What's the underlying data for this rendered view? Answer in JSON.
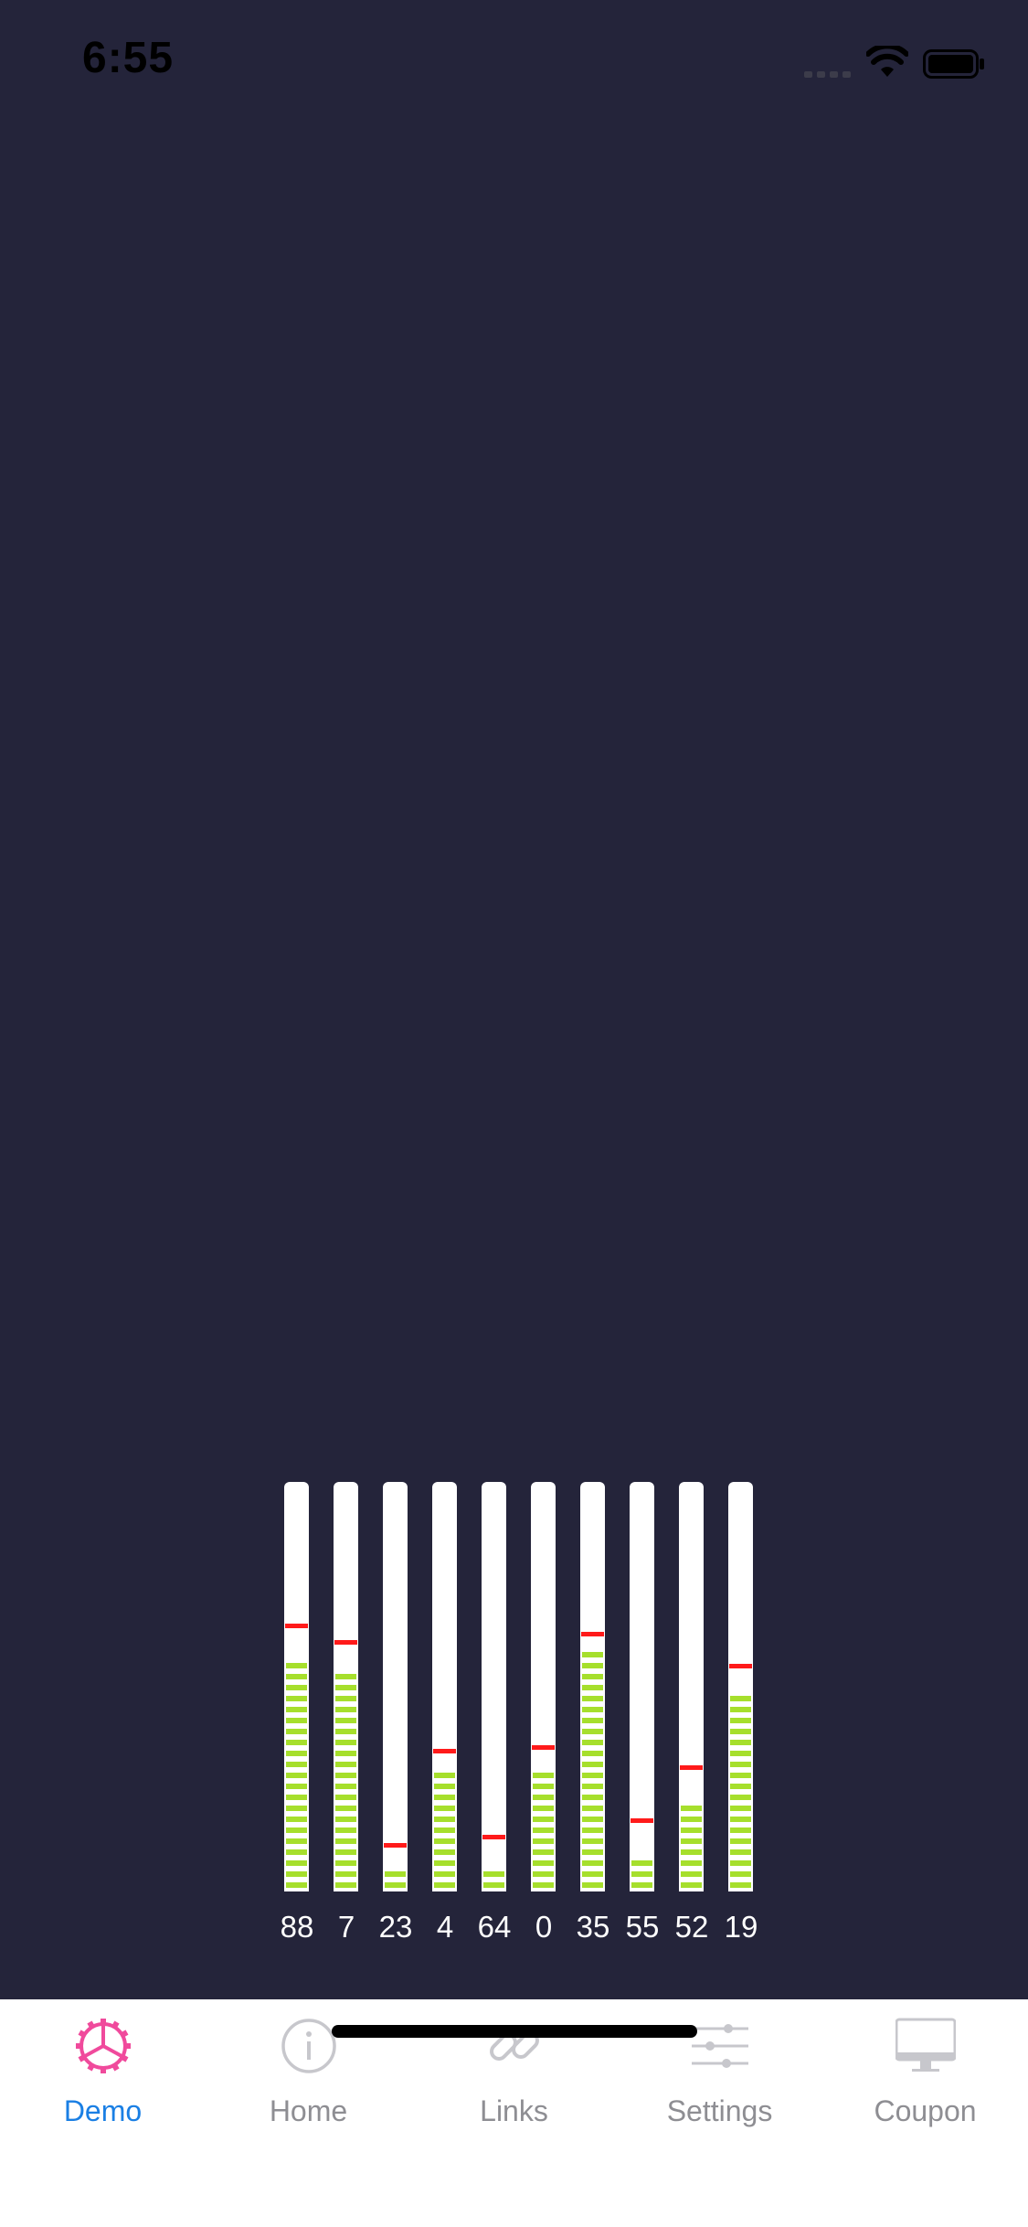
{
  "status_bar": {
    "time": "6:55",
    "icons": [
      "cellular-signal-icon",
      "wifi-icon",
      "battery-icon"
    ]
  },
  "meters": [
    {
      "label": "88",
      "level": 0.58,
      "peak": 0.64
    },
    {
      "label": "7",
      "level": 0.55,
      "peak": 0.6
    },
    {
      "label": "23",
      "level": 0.06,
      "peak": 0.1
    },
    {
      "label": "4",
      "level": 0.3,
      "peak": 0.33
    },
    {
      "label": "64",
      "level": 0.06,
      "peak": 0.12
    },
    {
      "label": "0",
      "level": 0.3,
      "peak": 0.34
    },
    {
      "label": "35",
      "level": 0.6,
      "peak": 0.62
    },
    {
      "label": "55",
      "level": 0.1,
      "peak": 0.16
    },
    {
      "label": "52",
      "level": 0.24,
      "peak": 0.29
    },
    {
      "label": "19",
      "level": 0.5,
      "peak": 0.54
    }
  ],
  "tab_bar": {
    "active_index": 0,
    "active_color": "#1a7fe4",
    "active_icon_color": "#f04a9c",
    "inactive_color": "#8e8e93",
    "tabs": [
      {
        "label": "Demo",
        "icon": "gear-icon"
      },
      {
        "label": "Home",
        "icon": "info-icon"
      },
      {
        "label": "Links",
        "icon": "link-icon"
      },
      {
        "label": "Settings",
        "icon": "sliders-icon"
      },
      {
        "label": "Coupon",
        "icon": "monitor-icon"
      }
    ]
  },
  "colors": {
    "background": "#24243a",
    "meter_bar": "#a6df2c",
    "meter_peak": "#ff1a1a",
    "meter_track": "#ffffff"
  }
}
